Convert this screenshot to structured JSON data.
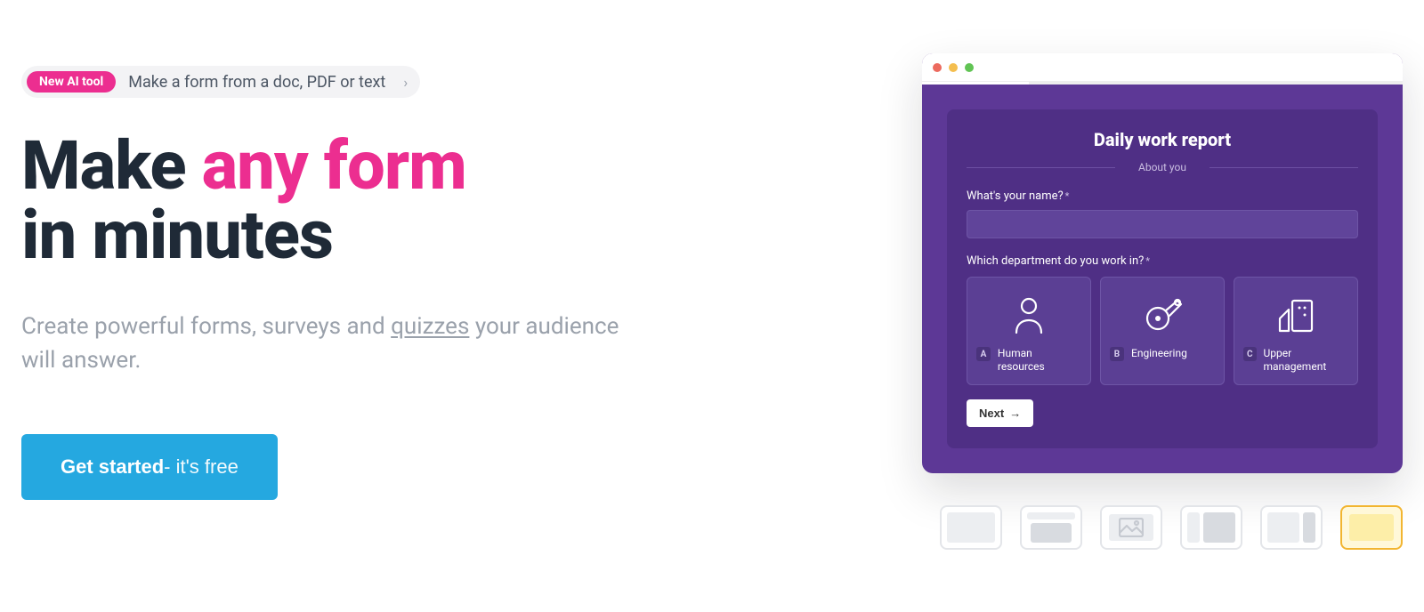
{
  "banner": {
    "badge": "New AI tool",
    "text": "Make a form from a doc, PDF or text"
  },
  "headline": {
    "part1": "Make ",
    "accent": "any form",
    "part2": " in minutes"
  },
  "sub": {
    "part1": "Create powerful forms, surveys and ",
    "underlined": "quizzes",
    "part2": " your audience will answer."
  },
  "cta": {
    "bold": "Get started",
    "rest": " - it's free"
  },
  "preview": {
    "title": "Daily work report",
    "section": "About you",
    "q1": "What's your name?",
    "q2": "Which department do you work in?",
    "options": [
      {
        "key": "A",
        "name": "Human resources"
      },
      {
        "key": "B",
        "name": "Engineering"
      },
      {
        "key": "C",
        "name": "Upper management"
      }
    ],
    "next": "Next"
  }
}
